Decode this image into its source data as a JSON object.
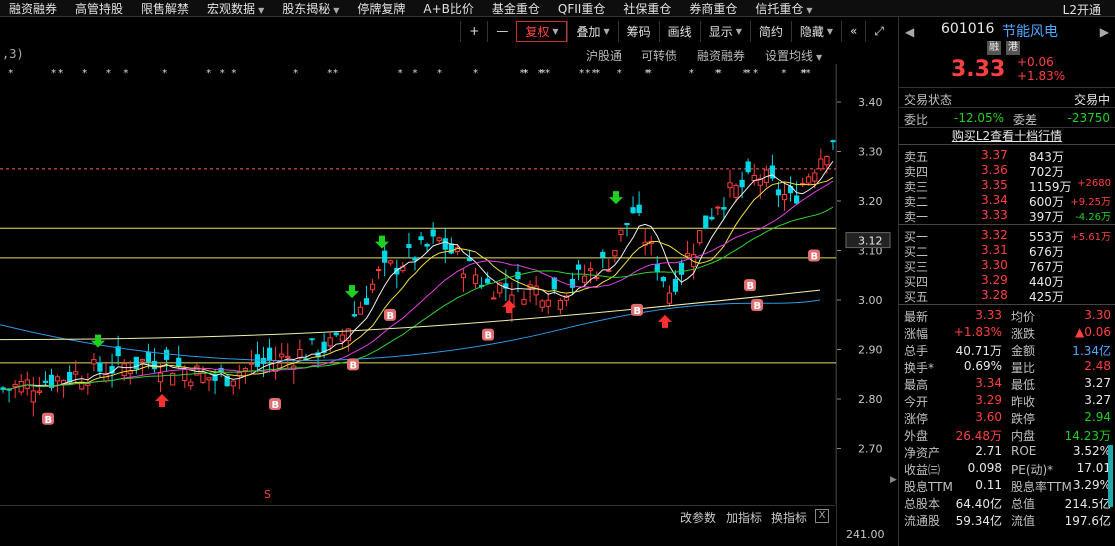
{
  "topbar": {
    "tabs": [
      {
        "label": "融资融券",
        "dropdown": false
      },
      {
        "label": "高管持股",
        "dropdown": false
      },
      {
        "label": "限售解禁",
        "dropdown": false
      },
      {
        "label": "宏观数据",
        "dropdown": true
      },
      {
        "label": "股东揭秘",
        "dropdown": true
      },
      {
        "label": "停牌复牌",
        "dropdown": false
      },
      {
        "label": "A+B比价",
        "dropdown": false
      },
      {
        "label": "基金重仓",
        "dropdown": false
      },
      {
        "label": "QFII重仓",
        "dropdown": false
      },
      {
        "label": "社保重仓",
        "dropdown": false
      },
      {
        "label": "券商重仓",
        "dropdown": false
      },
      {
        "label": "信托重仓",
        "dropdown": true
      }
    ],
    "l2": "L2开通"
  },
  "toolbar": {
    "plus": "+",
    "minus": "—",
    "fuquan": "复权",
    "diejia": "叠加",
    "chouma": "筹码",
    "huaxian": "画线",
    "xianshi": "显示",
    "jianyue": "简约",
    "yincang": "隐藏",
    "prev": "«",
    "expand": "⤢"
  },
  "subbar": {
    "indicator": ",3)",
    "items": [
      "沪股通",
      "可转债",
      "融资融券",
      "设置均线"
    ]
  },
  "chart": {
    "price_axis": [
      "3.40",
      "3.30",
      "3.20",
      "3.10",
      "3.00",
      "2.90",
      "2.80",
      "2.70"
    ],
    "current_marker": "3.12",
    "s_marker": "S",
    "b_marker": "B"
  },
  "bottombar": {
    "items": [
      "改参数",
      "加指标",
      "换指标"
    ],
    "close": "X",
    "value": "241.00"
  },
  "quote": {
    "code": "601016",
    "name": "节能风电",
    "badges": [
      "融",
      "港"
    ],
    "price": "3.33",
    "change": "+0.06",
    "change_pct": "+1.83%",
    "status_label": "交易状态",
    "status_value": "交易中",
    "weibi_label": "委比",
    "weibi_value": "-12.05%",
    "weicha_label": "委差",
    "weicha_value": "-23750",
    "l2_link": "购买L2查看十档行情",
    "asks": [
      {
        "label": "卖五",
        "price": "3.37",
        "vol": "843万",
        "delta": ""
      },
      {
        "label": "卖四",
        "price": "3.36",
        "vol": "702万",
        "delta": ""
      },
      {
        "label": "卖三",
        "price": "3.35",
        "vol": "1159万",
        "delta": "+2680"
      },
      {
        "label": "卖二",
        "price": "3.34",
        "vol": "600万",
        "delta": "+9.25万"
      },
      {
        "label": "卖一",
        "price": "3.33",
        "vol": "397万",
        "delta": "-4.26万"
      }
    ],
    "bids": [
      {
        "label": "买一",
        "price": "3.32",
        "vol": "553万",
        "delta": "+5.61万"
      },
      {
        "label": "买二",
        "price": "3.31",
        "vol": "676万",
        "delta": ""
      },
      {
        "label": "买三",
        "price": "3.30",
        "vol": "767万",
        "delta": ""
      },
      {
        "label": "买四",
        "price": "3.29",
        "vol": "440万",
        "delta": ""
      },
      {
        "label": "买五",
        "price": "3.28",
        "vol": "425万",
        "delta": ""
      }
    ],
    "stats": [
      {
        "l1": "最新",
        "v1": "3.33",
        "c1": "red",
        "l2": "均价",
        "v2": "3.30",
        "c2": "red"
      },
      {
        "l1": "涨幅",
        "v1": "+1.83%",
        "c1": "red",
        "l2": "涨跌",
        "v2": "▲0.06",
        "c2": "red"
      },
      {
        "l1": "总手",
        "v1": "40.71万",
        "c1": "white",
        "l2": "金额",
        "v2": "1.34亿",
        "c2": "blue"
      },
      {
        "l1": "换手*",
        "v1": "0.69%",
        "c1": "white",
        "l2": "量比",
        "v2": "2.48",
        "c2": "red"
      },
      {
        "l1": "最高",
        "v1": "3.34",
        "c1": "red",
        "l2": "最低",
        "v2": "3.27",
        "c2": "white"
      },
      {
        "l1": "今开",
        "v1": "3.29",
        "c1": "red",
        "l2": "昨收",
        "v2": "3.27",
        "c2": "white"
      },
      {
        "l1": "涨停",
        "v1": "3.60",
        "c1": "red",
        "l2": "跌停",
        "v2": "2.94",
        "c2": "green"
      },
      {
        "l1": "外盘",
        "v1": "26.48万",
        "c1": "red",
        "l2": "内盘",
        "v2": "14.23万",
        "c2": "green"
      },
      {
        "l1": "净资产",
        "v1": "2.71",
        "c1": "white",
        "l2": "ROE",
        "v2": "3.52%",
        "c2": "white"
      },
      {
        "l1": "收益㈢",
        "v1": "0.098",
        "c1": "white",
        "l2": "PE(动)*",
        "v2": "17.01",
        "c2": "white"
      },
      {
        "l1": "股息TTM",
        "v1": "0.11",
        "c1": "white",
        "l2": "股息率TTM",
        "v2": "3.29%",
        "c2": "white"
      },
      {
        "l1": "总股本",
        "v1": "64.40亿",
        "c1": "white",
        "l2": "总值",
        "v2": "214.5亿",
        "c2": "white"
      },
      {
        "l1": "流通股",
        "v1": "59.34亿",
        "c1": "white",
        "l2": "流值",
        "v2": "197.6亿",
        "c2": "white"
      }
    ]
  }
}
